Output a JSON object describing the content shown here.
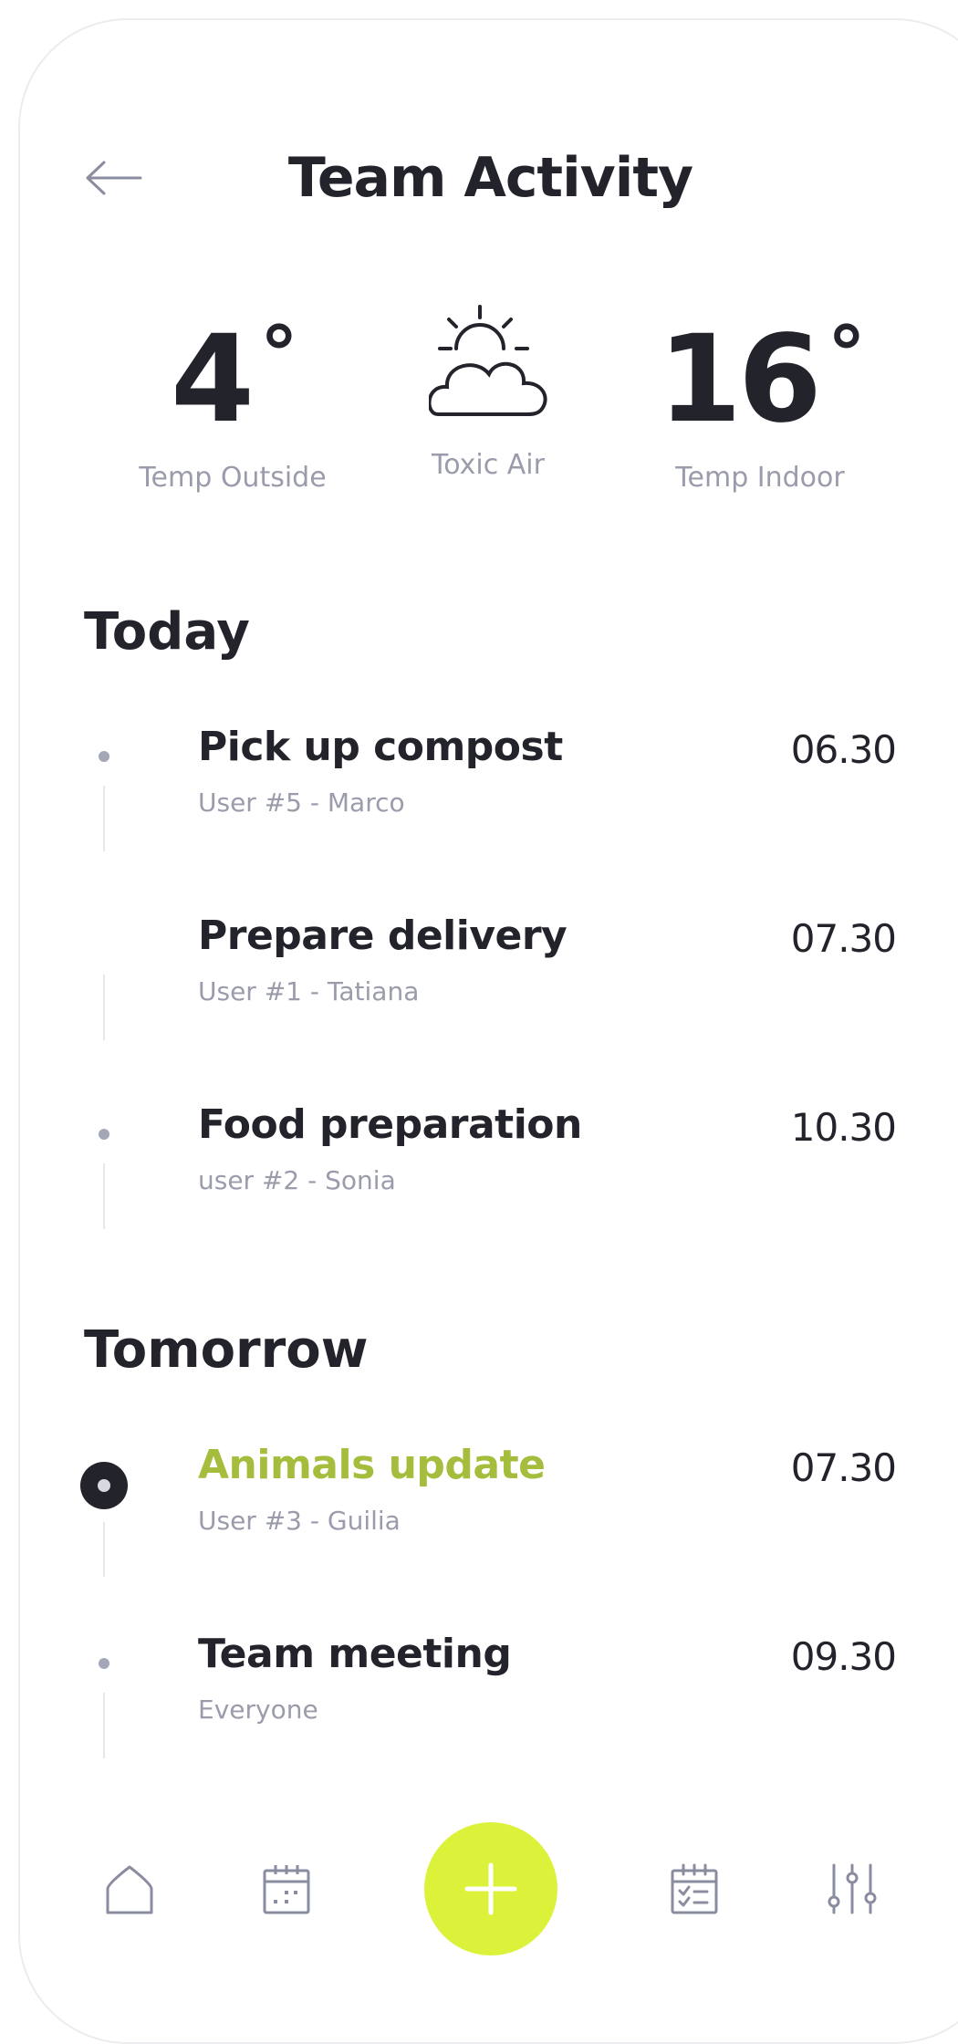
{
  "header": {
    "title": "Team Activity"
  },
  "stats": {
    "outside": {
      "value": "4",
      "unit": "°",
      "label": "Temp Outside"
    },
    "air": {
      "label": "Toxic Air",
      "icon": "sun-cloud-icon"
    },
    "indoor": {
      "value": "16",
      "unit": "°",
      "label": "Temp Indoor"
    }
  },
  "sections": {
    "today": "Today",
    "tomorrow": "Tomorrow"
  },
  "today": [
    {
      "name": "Pick up compost",
      "user": "User #5 - Marco",
      "time": "06.30"
    },
    {
      "name": "Prepare delivery",
      "user": "User #1 - Tatiana",
      "time": "07.30"
    },
    {
      "name": "Food preparation",
      "user": "user #2 - Sonia",
      "time": "10.30"
    }
  ],
  "tomorrow": [
    {
      "name": "Animals update",
      "user": "User #3 - Guilia",
      "time": "07.30"
    },
    {
      "name": "Team meeting",
      "user": "Everyone",
      "time": "09.30"
    }
  ],
  "colors": {
    "accent": "#dcf23a",
    "active_text": "#a4bd3c",
    "text": "#23232b",
    "muted": "#9a9cab"
  },
  "nav": {
    "icons": [
      "home-icon",
      "calendar-icon",
      "add-icon",
      "checklist-icon",
      "sliders-icon"
    ]
  }
}
